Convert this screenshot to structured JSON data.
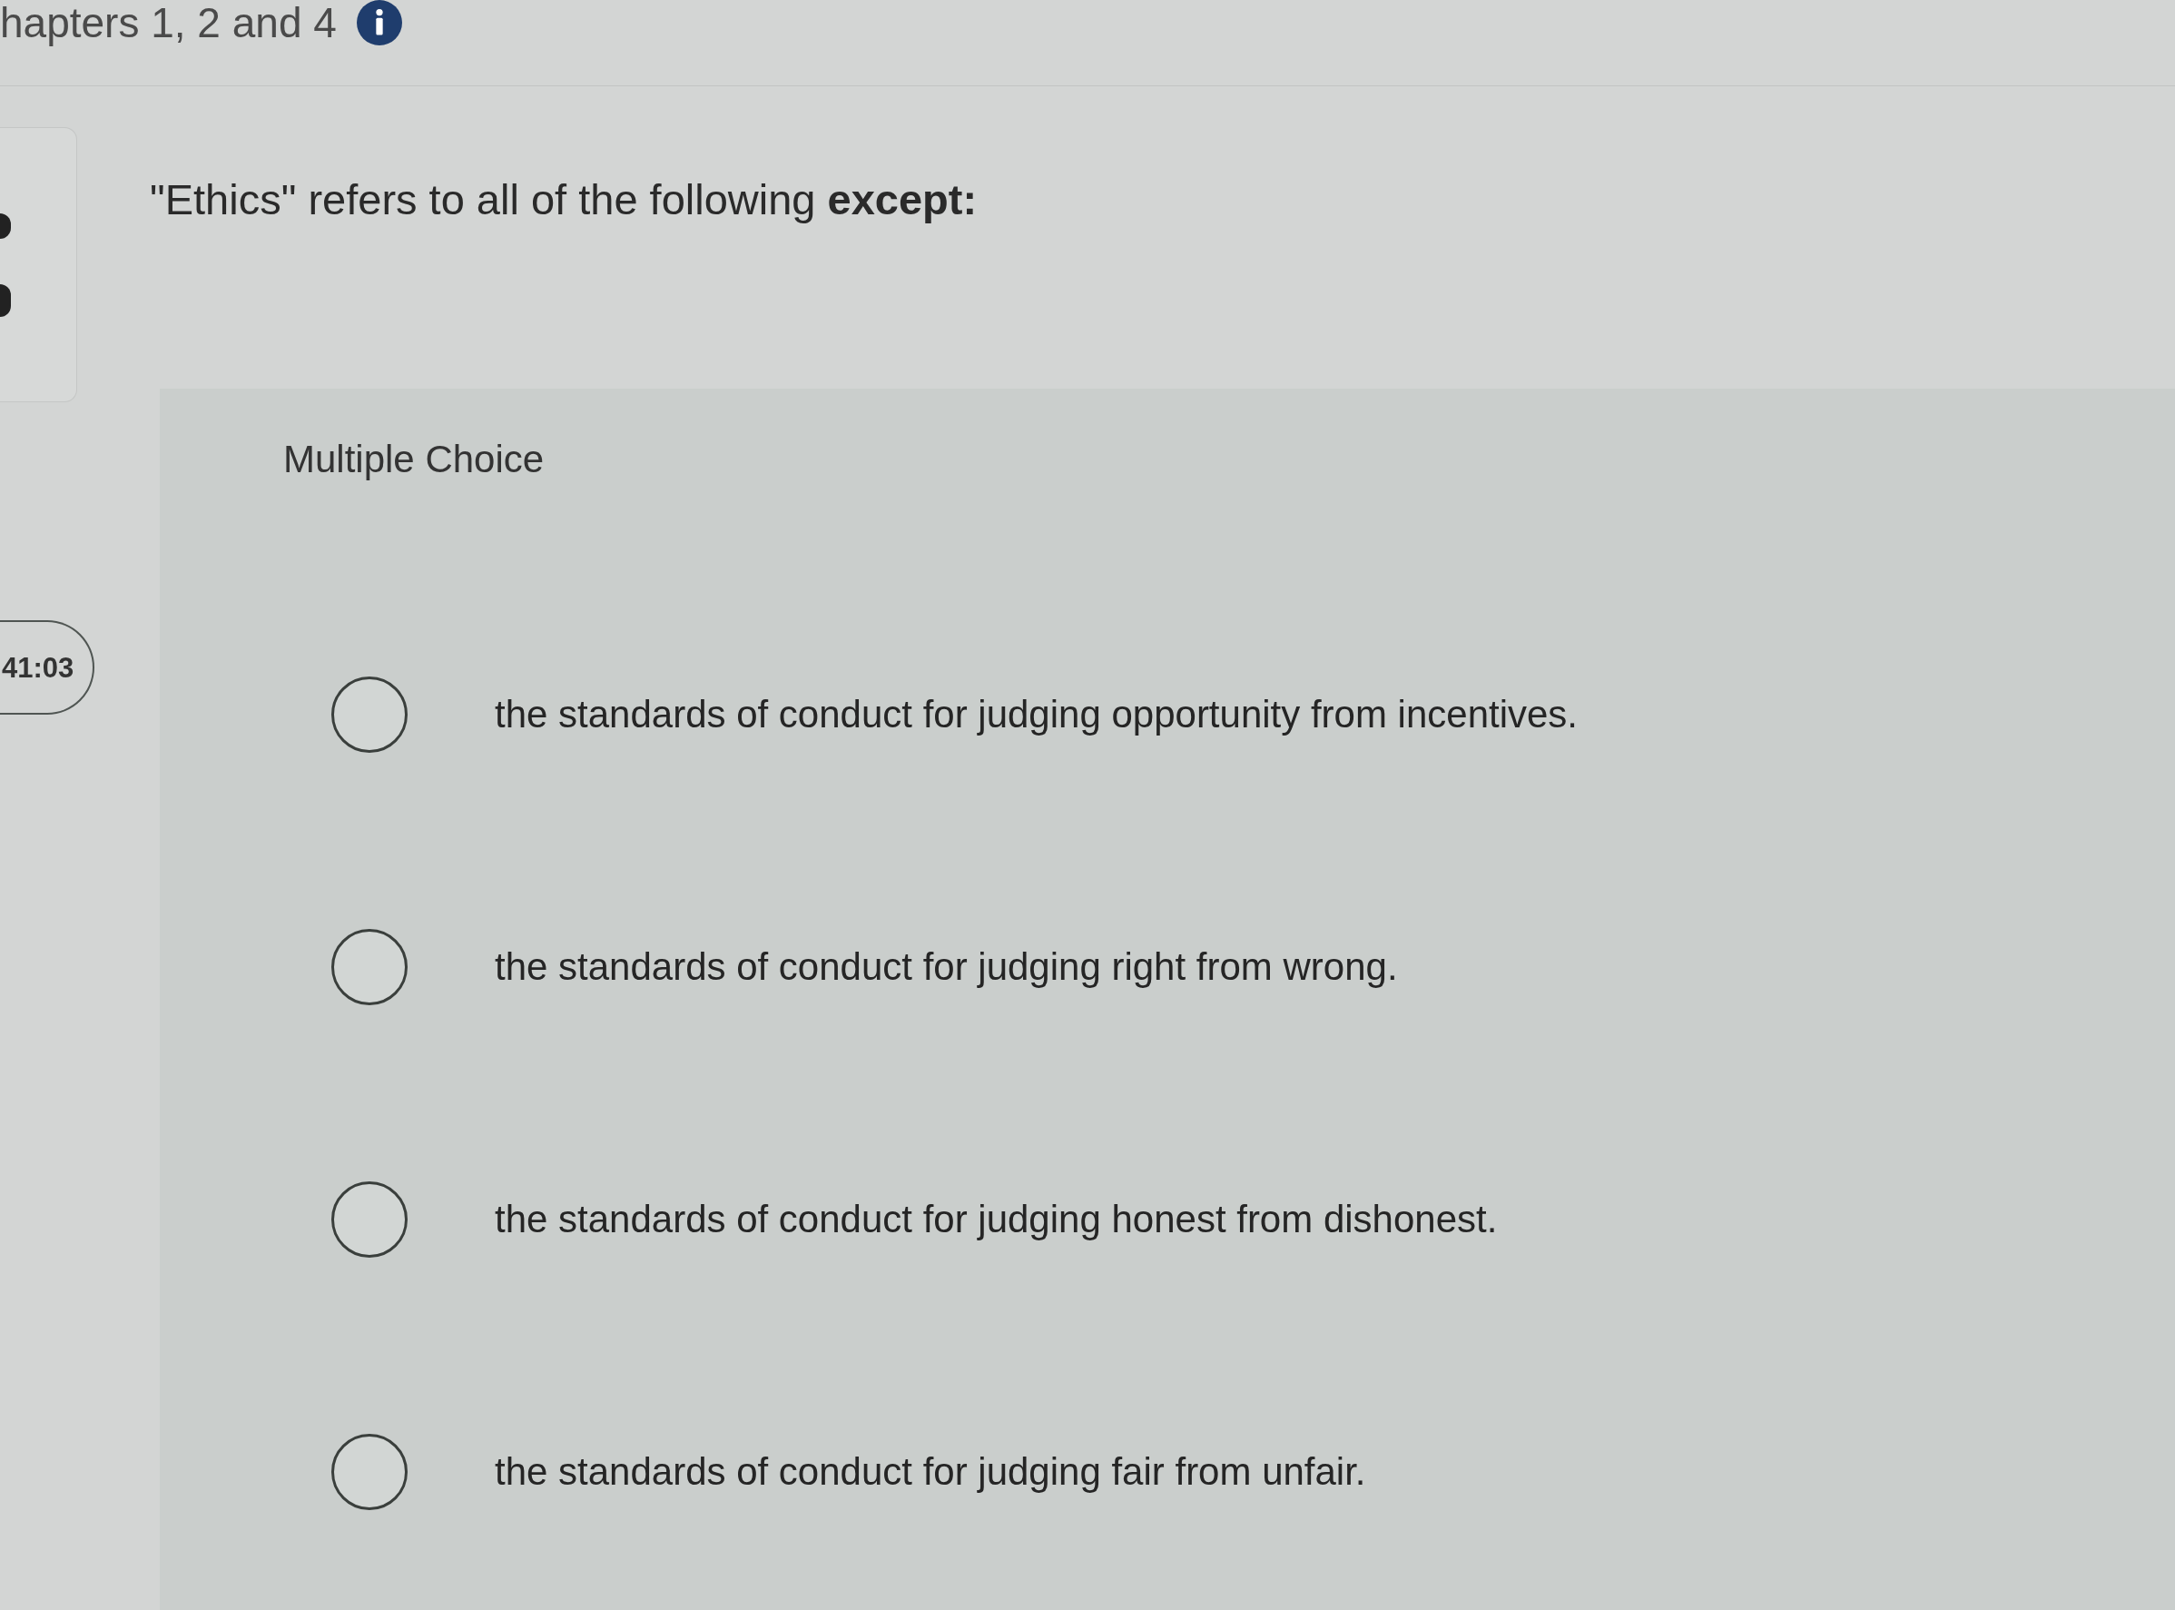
{
  "header": {
    "title": "hapters 1, 2 and 4"
  },
  "timer": {
    "text": "41:03"
  },
  "question": {
    "prompt": "\"Ethics\" refers to all of the following **except:**"
  },
  "answer_area": {
    "type_label": "Multiple Choice",
    "options": [
      {
        "text": "the standards of conduct for judging opportunity from incentives.",
        "selected": false
      },
      {
        "text": "the standards of conduct for judging right from wrong.",
        "selected": false
      },
      {
        "text": "the standards of conduct for judging honest from dishonest.",
        "selected": false
      },
      {
        "text": "the standards of conduct for judging fair from unfair.",
        "selected": false
      }
    ]
  }
}
